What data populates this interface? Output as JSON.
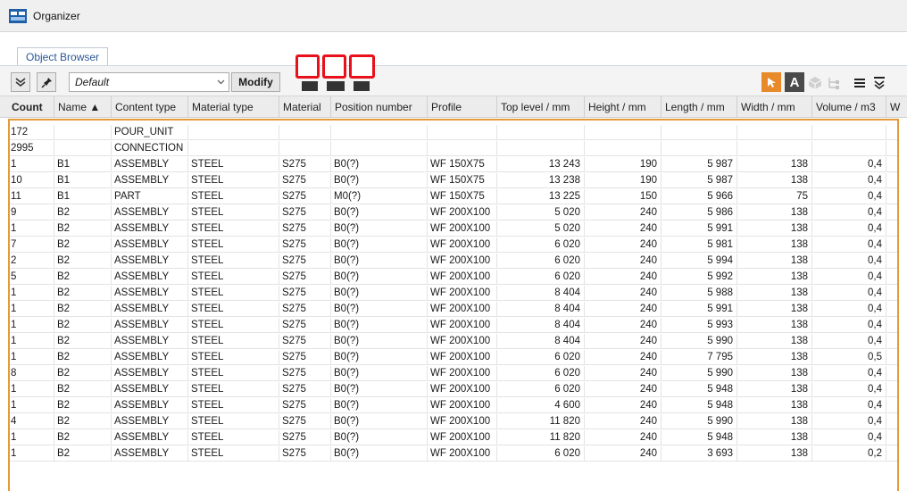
{
  "window": {
    "title": "Organizer"
  },
  "tabs": [
    {
      "label": "Object Browser"
    }
  ],
  "toolbar": {
    "view_value": "Default",
    "modify_label": "Modify",
    "text_button_label": "A"
  },
  "columns": [
    "Count",
    "Name ▲",
    "Content type",
    "Material type",
    "Material",
    "Position number",
    "Profile",
    "Top level / mm",
    "Height / mm",
    "Length / mm",
    "Width / mm",
    "Volume / m3",
    "W"
  ],
  "rows": [
    [
      "172",
      "",
      "POUR_UNIT",
      "",
      "",
      "",
      "",
      "",
      "",
      "",
      "",
      ""
    ],
    [
      "2995",
      "",
      "CONNECTION",
      "",
      "",
      "",
      "",
      "",
      "",
      "",
      "",
      ""
    ],
    [
      "1",
      "B1",
      "ASSEMBLY",
      "STEEL",
      "S275",
      "B0(?)",
      "WF 150X75",
      "13 243",
      "190",
      "5 987",
      "138",
      "0,4"
    ],
    [
      "10",
      "B1",
      "ASSEMBLY",
      "STEEL",
      "S275",
      "B0(?)",
      "WF 150X75",
      "13 238",
      "190",
      "5 987",
      "138",
      "0,4"
    ],
    [
      "11",
      "B1",
      "PART",
      "STEEL",
      "S275",
      "M0(?)",
      "WF 150X75",
      "13 225",
      "150",
      "5 966",
      "75",
      "0,4"
    ],
    [
      "9",
      "B2",
      "ASSEMBLY",
      "STEEL",
      "S275",
      "B0(?)",
      "WF 200X100",
      "5 020",
      "240",
      "5 986",
      "138",
      "0,4"
    ],
    [
      "1",
      "B2",
      "ASSEMBLY",
      "STEEL",
      "S275",
      "B0(?)",
      "WF 200X100",
      "5 020",
      "240",
      "5 991",
      "138",
      "0,4"
    ],
    [
      "7",
      "B2",
      "ASSEMBLY",
      "STEEL",
      "S275",
      "B0(?)",
      "WF 200X100",
      "6 020",
      "240",
      "5 981",
      "138",
      "0,4"
    ],
    [
      "2",
      "B2",
      "ASSEMBLY",
      "STEEL",
      "S275",
      "B0(?)",
      "WF 200X100",
      "6 020",
      "240",
      "5 994",
      "138",
      "0,4"
    ],
    [
      "5",
      "B2",
      "ASSEMBLY",
      "STEEL",
      "S275",
      "B0(?)",
      "WF 200X100",
      "6 020",
      "240",
      "5 992",
      "138",
      "0,4"
    ],
    [
      "1",
      "B2",
      "ASSEMBLY",
      "STEEL",
      "S275",
      "B0(?)",
      "WF 200X100",
      "8 404",
      "240",
      "5 988",
      "138",
      "0,4"
    ],
    [
      "1",
      "B2",
      "ASSEMBLY",
      "STEEL",
      "S275",
      "B0(?)",
      "WF 200X100",
      "8 404",
      "240",
      "5 991",
      "138",
      "0,4"
    ],
    [
      "1",
      "B2",
      "ASSEMBLY",
      "STEEL",
      "S275",
      "B0(?)",
      "WF 200X100",
      "8 404",
      "240",
      "5 993",
      "138",
      "0,4"
    ],
    [
      "1",
      "B2",
      "ASSEMBLY",
      "STEEL",
      "S275",
      "B0(?)",
      "WF 200X100",
      "8 404",
      "240",
      "5 990",
      "138",
      "0,4"
    ],
    [
      "1",
      "B2",
      "ASSEMBLY",
      "STEEL",
      "S275",
      "B0(?)",
      "WF 200X100",
      "6 020",
      "240",
      "7 795",
      "138",
      "0,5"
    ],
    [
      "8",
      "B2",
      "ASSEMBLY",
      "STEEL",
      "S275",
      "B0(?)",
      "WF 200X100",
      "6 020",
      "240",
      "5 990",
      "138",
      "0,4"
    ],
    [
      "1",
      "B2",
      "ASSEMBLY",
      "STEEL",
      "S275",
      "B0(?)",
      "WF 200X100",
      "6 020",
      "240",
      "5 948",
      "138",
      "0,4"
    ],
    [
      "1",
      "B2",
      "ASSEMBLY",
      "STEEL",
      "S275",
      "B0(?)",
      "WF 200X100",
      "4 600",
      "240",
      "5 948",
      "138",
      "0,4"
    ],
    [
      "4",
      "B2",
      "ASSEMBLY",
      "STEEL",
      "S275",
      "B0(?)",
      "WF 200X100",
      "11 820",
      "240",
      "5 990",
      "138",
      "0,4"
    ],
    [
      "1",
      "B2",
      "ASSEMBLY",
      "STEEL",
      "S275",
      "B0(?)",
      "WF 200X100",
      "11 820",
      "240",
      "5 948",
      "138",
      "0,4"
    ],
    [
      "1",
      "B2",
      "ASSEMBLY",
      "STEEL",
      "S275",
      "B0(?)",
      "WF 200X100",
      "6 020",
      "240",
      "3 693",
      "138",
      "0,2"
    ]
  ],
  "colors": {
    "accent_orange": "#e8892a",
    "grid_border": "#e39a3b",
    "highlight_red": "#e8101b",
    "tab_text": "#2b5797"
  }
}
